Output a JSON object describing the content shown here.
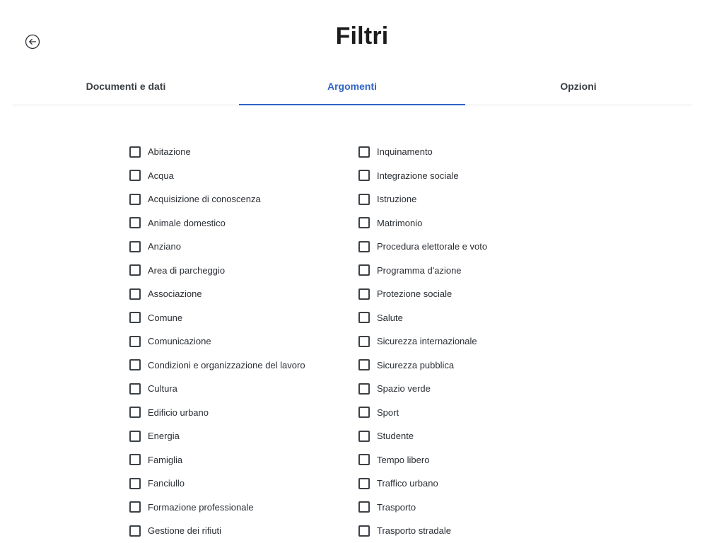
{
  "header": {
    "title": "Filtri",
    "back_icon": "arrow-left-circle-icon"
  },
  "tabs": [
    {
      "label": "Documenti e dati",
      "active": false
    },
    {
      "label": "Argomenti",
      "active": true
    },
    {
      "label": "Opzioni",
      "active": false
    }
  ],
  "colors": {
    "accent": "#2f64c4",
    "text": "#2a2e33",
    "divider": "#e3e5e8"
  },
  "filters": {
    "left": [
      {
        "label": "Abitazione",
        "checked": false
      },
      {
        "label": "Acqua",
        "checked": false
      },
      {
        "label": "Acquisizione di conoscenza",
        "checked": false
      },
      {
        "label": "Animale domestico",
        "checked": false
      },
      {
        "label": "Anziano",
        "checked": false
      },
      {
        "label": "Area di parcheggio",
        "checked": false
      },
      {
        "label": "Associazione",
        "checked": false
      },
      {
        "label": "Comune",
        "checked": false
      },
      {
        "label": "Comunicazione",
        "checked": false
      },
      {
        "label": "Condizioni e organizzazione del lavoro",
        "checked": false
      },
      {
        "label": "Cultura",
        "checked": false
      },
      {
        "label": "Edificio urbano",
        "checked": false
      },
      {
        "label": "Energia",
        "checked": false
      },
      {
        "label": "Famiglia",
        "checked": false
      },
      {
        "label": "Fanciullo",
        "checked": false
      },
      {
        "label": "Formazione professionale",
        "checked": false
      },
      {
        "label": "Gestione dei rifiuti",
        "checked": false
      }
    ],
    "right": [
      {
        "label": "Inquinamento",
        "checked": false
      },
      {
        "label": "Integrazione sociale",
        "checked": false
      },
      {
        "label": "Istruzione",
        "checked": false
      },
      {
        "label": "Matrimonio",
        "checked": false
      },
      {
        "label": "Procedura elettorale e voto",
        "checked": false
      },
      {
        "label": "Programma d'azione",
        "checked": false
      },
      {
        "label": "Protezione sociale",
        "checked": false
      },
      {
        "label": "Salute",
        "checked": false
      },
      {
        "label": "Sicurezza internazionale",
        "checked": false
      },
      {
        "label": "Sicurezza pubblica",
        "checked": false
      },
      {
        "label": "Spazio verde",
        "checked": false
      },
      {
        "label": "Sport",
        "checked": false
      },
      {
        "label": "Studente",
        "checked": false
      },
      {
        "label": "Tempo libero",
        "checked": false
      },
      {
        "label": "Traffico urbano",
        "checked": false
      },
      {
        "label": "Trasporto",
        "checked": false
      },
      {
        "label": "Trasporto stradale",
        "checked": false
      }
    ]
  }
}
